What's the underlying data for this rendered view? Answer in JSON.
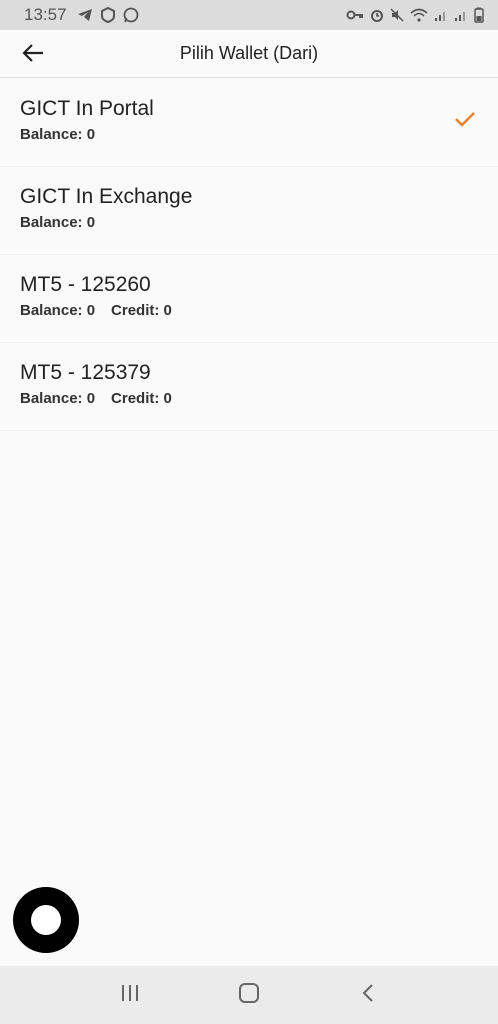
{
  "status_bar": {
    "time": "13:57",
    "left_icons": [
      "telegram-icon",
      "vpn-icon",
      "whatsapp-icon"
    ],
    "right_icons": [
      "key-icon",
      "alarm-icon",
      "mute-icon",
      "wifi-icon",
      "signal-icon",
      "signal-icon",
      "battery-icon"
    ]
  },
  "app_bar": {
    "title": "Pilih Wallet (Dari)",
    "back_icon": "arrow-left-icon"
  },
  "wallets": [
    {
      "name": "GICT In Portal",
      "balance": "Balance: 0",
      "credit": "",
      "selected": true
    },
    {
      "name": "GICT In Exchange",
      "balance": "Balance: 0",
      "credit": "",
      "selected": false
    },
    {
      "name": "MT5 - 125260",
      "balance": "Balance: 0",
      "credit": "Credit: 0",
      "selected": false
    },
    {
      "name": "MT5 - 125379",
      "balance": "Balance: 0",
      "credit": "Credit: 0",
      "selected": false
    }
  ],
  "colors": {
    "accent": "#e8822a",
    "fab": "#000000",
    "status_bar": "#dcdcdc",
    "nav_bar": "#ebebeb"
  },
  "nav_bar": {
    "buttons": [
      "recent-apps-icon",
      "home-icon",
      "back-icon"
    ]
  }
}
